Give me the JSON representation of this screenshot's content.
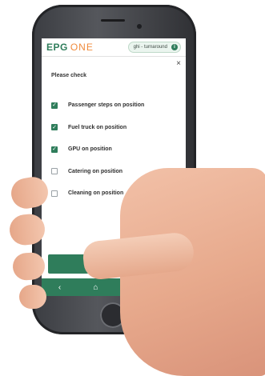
{
  "app": {
    "logo_primary": "EPG",
    "logo_secondary": "ONE",
    "context_label": "ghi - turnaround",
    "info_icon": "i",
    "close_icon": "×"
  },
  "dialog": {
    "heading": "Please check",
    "items": [
      {
        "label": "Passenger steps on position",
        "checked": true
      },
      {
        "label": "Fuel truck on position",
        "checked": true
      },
      {
        "label": "GPU on position",
        "checked": true
      },
      {
        "label": "Catering on position",
        "checked": false
      },
      {
        "label": "Cleaning on position",
        "checked": false
      }
    ]
  },
  "nav": {
    "back_icon": "‹",
    "home_icon": "⌂",
    "bell_icon": "🔔"
  },
  "colors": {
    "brand_green": "#2f7d5b",
    "brand_orange": "#f08a3b"
  }
}
